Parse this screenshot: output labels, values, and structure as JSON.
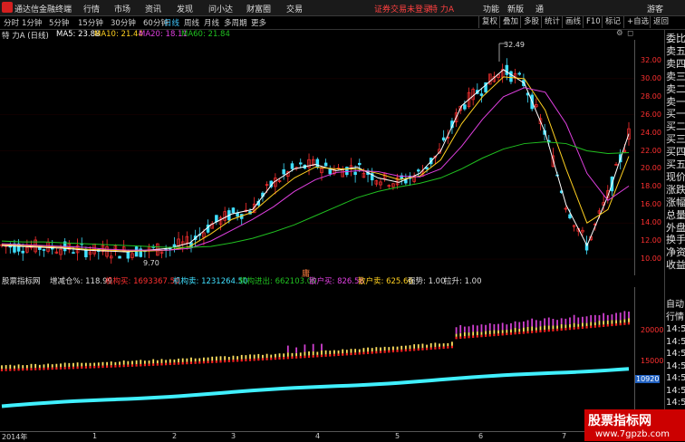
{
  "menu": {
    "app_title": "通达信金融终端",
    "items": [
      "行情",
      "市场",
      "资讯",
      "发现",
      "问小达",
      "财富圈",
      "交易"
    ],
    "alert": "证券交易未登录",
    "stock": "特 力A",
    "right": [
      "功能",
      "新版",
      "通",
      "游客"
    ]
  },
  "toolbar": {
    "periods": [
      "分时",
      "1分钟",
      "5分钟",
      "15分钟",
      "30分钟",
      "60分钟",
      "日线",
      "周线",
      "月线",
      "多周期",
      "更多"
    ],
    "active": "日线",
    "right": [
      "复权",
      "叠加",
      "多股",
      "统计",
      "画线",
      "F10",
      "标记",
      "+自选",
      "返回"
    ]
  },
  "info": {
    "stock_label": "特 力A (日线)",
    "ma5": "MA5: 23.88",
    "ma10": "MA10: 21.44",
    "ma20": "MA20: 18.11",
    "ma60": "MA60: 21.84"
  },
  "price_axis": [
    "32.00",
    "30.00",
    "28.00",
    "26.00",
    "24.00",
    "22.00",
    "20.00",
    "18.00",
    "16.00",
    "14.00",
    "12.00",
    "10.00"
  ],
  "annotations": {
    "high": "32.49",
    "low": "9.70",
    "marker": "庸"
  },
  "indicator": {
    "name": "股票指标网",
    "v1": "增减仓%: 118.99",
    "v2": "机构买: 1693367.50",
    "v3": "机构卖: 1231264.50",
    "v4": "机构进出: 662103.00",
    "v5": "散户买: 826.58",
    "v6": "散户卖: 625.66",
    "v7": "强势: 1.00",
    "v8": "拉升: 1.00"
  },
  "volume_axis": [
    "20000",
    "15000",
    "10920",
    "5000"
  ],
  "right_panel": [
    "委比",
    "卖五",
    "卖四",
    "卖三",
    "卖二",
    "卖一",
    "买一",
    "买二",
    "买三",
    "买四",
    "买五",
    "现价",
    "涨跌",
    "涨幅",
    "总量",
    "外盘",
    "换手",
    "净资",
    "收益"
  ],
  "right_panel2": [
    "自动",
    "行情",
    "14:5",
    "14:5",
    "14:5",
    "14:5",
    "14:5",
    "14:5",
    "14:5",
    "14:5"
  ],
  "time_axis": [
    "2014年",
    "1",
    "2",
    "3",
    "4",
    "5",
    "6",
    "7"
  ],
  "watermark": {
    "title": "股票指标网",
    "url": "www.7gpzb.com"
  },
  "colors": {
    "up": "#ff3030",
    "down": "#40e0ff",
    "ma5": "#ffffff",
    "ma10": "#ffd020",
    "ma20": "#e040e0",
    "ma60": "#20c020"
  },
  "chart_data": {
    "type": "line",
    "title": "",
    "xlabel": "",
    "ylabel": "",
    "ylim": [
      9.0,
      33.5
    ],
    "x": [
      0,
      5,
      10,
      15,
      20,
      25,
      30,
      35,
      40,
      45,
      50,
      55,
      60,
      65,
      70,
      75,
      80,
      85,
      90,
      95,
      100,
      105,
      110,
      115,
      120,
      125,
      130,
      135,
      140,
      145,
      150
    ],
    "series": [
      {
        "name": "MA5",
        "values": [
          11.5,
          11.4,
          11.3,
          11.2,
          11.0,
          10.9,
          10.8,
          11.0,
          11.2,
          11.8,
          13.8,
          15.0,
          15.5,
          18.5,
          20.0,
          20.5,
          19.8,
          20.2,
          19.0,
          18.5,
          19.5,
          22.0,
          27.0,
          29.0,
          31.0,
          29.5,
          24.0,
          16.0,
          11.5,
          17.0,
          23.9
        ]
      },
      {
        "name": "MA10",
        "values": [
          11.6,
          11.5,
          11.4,
          11.3,
          11.1,
          11.0,
          10.9,
          10.9,
          11.0,
          11.4,
          12.8,
          14.4,
          15.2,
          17.2,
          19.0,
          20.2,
          20.0,
          20.0,
          19.5,
          18.8,
          19.2,
          21.0,
          25.0,
          28.0,
          30.2,
          30.0,
          26.5,
          20.0,
          14.0,
          15.5,
          21.4
        ]
      },
      {
        "name": "MA20",
        "values": [
          11.7,
          11.6,
          11.5,
          11.4,
          11.3,
          11.1,
          11.0,
          11.0,
          11.0,
          11.2,
          12.0,
          13.2,
          14.4,
          15.8,
          17.5,
          18.8,
          19.6,
          19.8,
          19.7,
          19.2,
          19.1,
          20.0,
          22.5,
          25.5,
          28.0,
          29.0,
          28.5,
          25.0,
          19.5,
          16.5,
          18.1
        ]
      },
      {
        "name": "MA60",
        "values": [
          12.0,
          11.9,
          11.9,
          11.8,
          11.7,
          11.6,
          11.5,
          11.4,
          11.3,
          11.3,
          11.4,
          11.8,
          12.3,
          13.0,
          13.8,
          14.8,
          15.8,
          16.8,
          17.5,
          18.0,
          18.4,
          19.0,
          20.0,
          21.2,
          22.2,
          22.8,
          23.0,
          22.8,
          22.0,
          21.7,
          21.8
        ]
      }
    ]
  }
}
